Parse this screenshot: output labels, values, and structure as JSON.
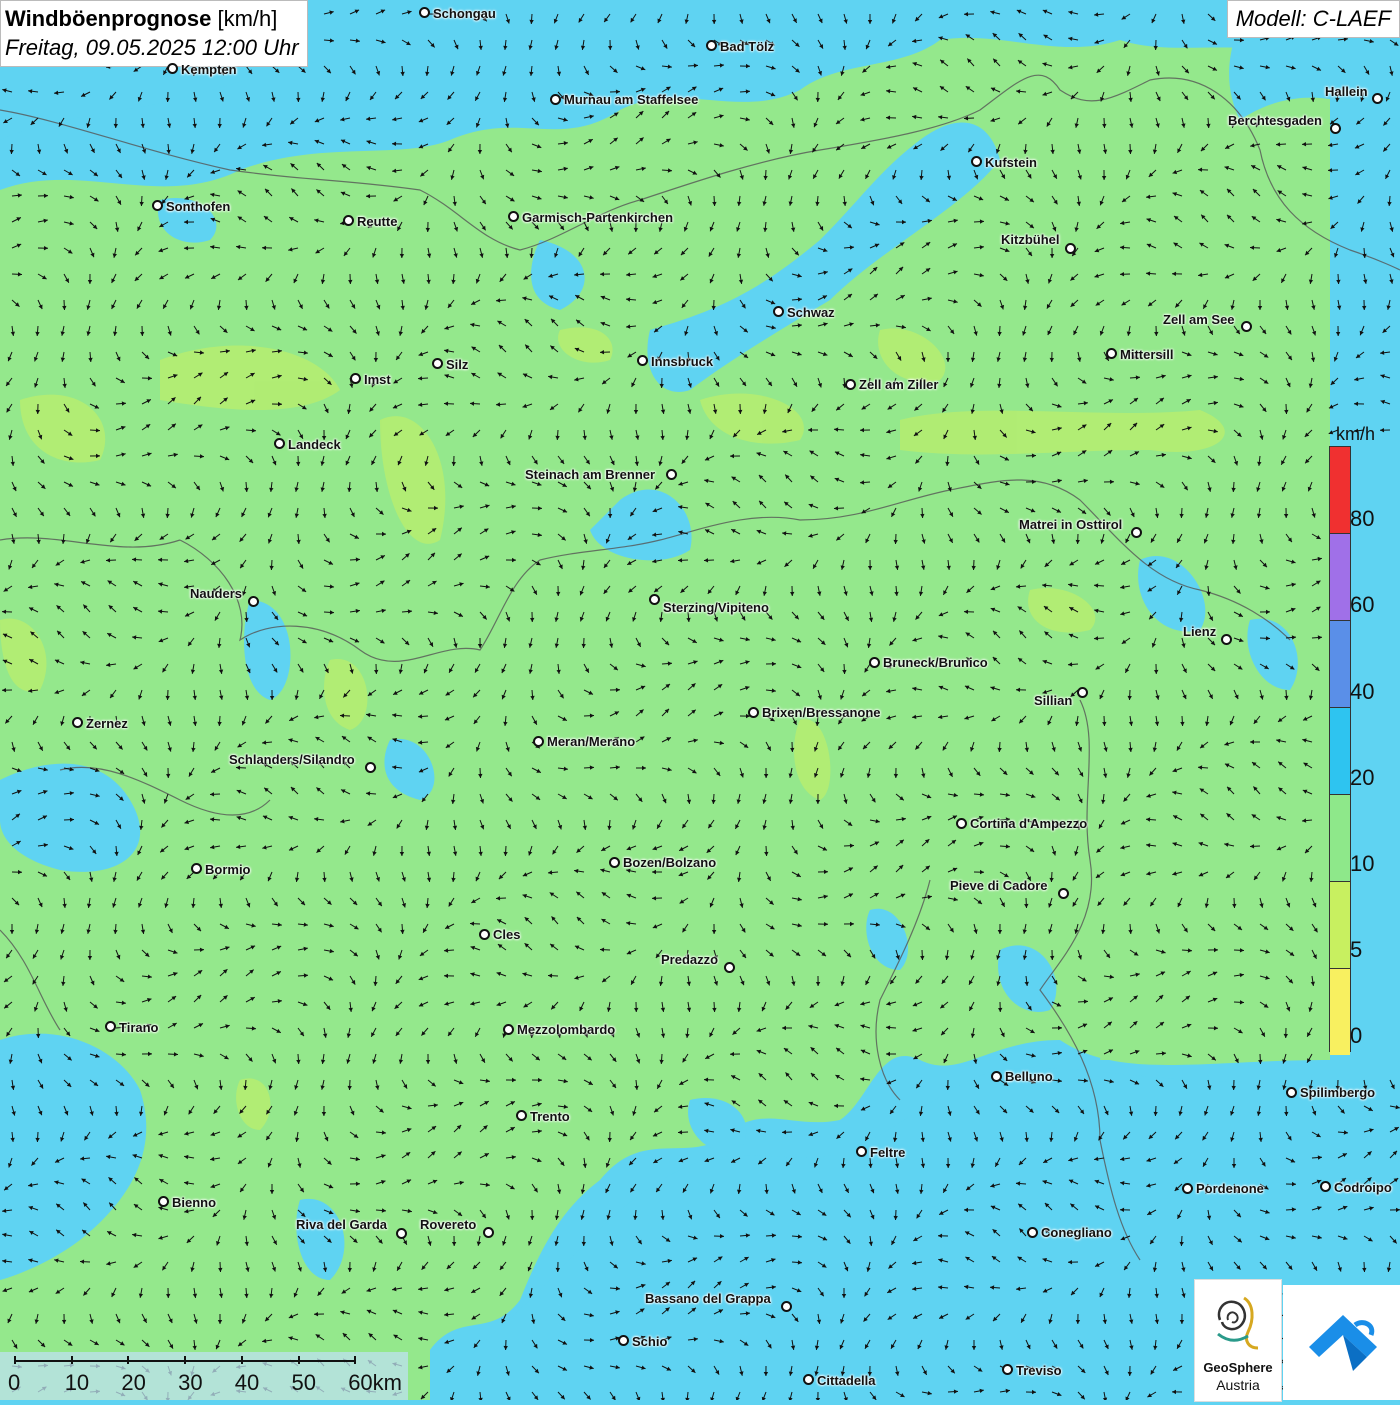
{
  "title": {
    "bold": "Windböenprognose",
    "unit": "[km/h]",
    "datetime": "Freitag, 09.05.2025 12:00 Uhr"
  },
  "model": "Modell: C-LAEF",
  "legend": {
    "unit": "km/h",
    "labels": [
      "80",
      "60",
      "40",
      "20",
      "10",
      "5",
      "0"
    ],
    "colors": [
      "#f03030",
      "#a070e8",
      "#5a8fe8",
      "#2ec4f0",
      "#8ee88a",
      "#c8f060",
      "#f8f060"
    ]
  },
  "scale": {
    "labels": [
      "0",
      "10",
      "20",
      "30",
      "40",
      "50",
      "60km"
    ]
  },
  "logos": {
    "geosphere_line1": "GeoSphere",
    "geosphere_line2": "Austria",
    "app_icon": "wind-app-icon"
  },
  "cities": [
    {
      "name": "Schongau"
    },
    {
      "name": "Bad Tölz"
    },
    {
      "name": "Kempten"
    },
    {
      "name": "Murnau am Staffelsee"
    },
    {
      "name": "Hallein"
    },
    {
      "name": "Berchtesgaden"
    },
    {
      "name": "Kufstein"
    },
    {
      "name": "Sonthofen"
    },
    {
      "name": "Reutte"
    },
    {
      "name": "Garmisch-Partenkirchen"
    },
    {
      "name": "Kitzbühel"
    },
    {
      "name": "Schwaz"
    },
    {
      "name": "Zell am See"
    },
    {
      "name": "Mittersill"
    },
    {
      "name": "Innsbruck"
    },
    {
      "name": "Silz"
    },
    {
      "name": "Imst"
    },
    {
      "name": "Zell am Ziller"
    },
    {
      "name": "Landeck"
    },
    {
      "name": "Steinach am Brenner"
    },
    {
      "name": "Matrei in Osttirol"
    },
    {
      "name": "Nauders"
    },
    {
      "name": "Sterzing/Vipiteno"
    },
    {
      "name": "Lienz"
    },
    {
      "name": "Bruneck/Brunico"
    },
    {
      "name": "Sillian"
    },
    {
      "name": "Zernez"
    },
    {
      "name": "Brixen/Bressanone"
    },
    {
      "name": "Meran/Merano"
    },
    {
      "name": "Schlanders/Silandro"
    },
    {
      "name": "Cortina d'Ampezzo"
    },
    {
      "name": "Bormio"
    },
    {
      "name": "Bozen/Bolzano"
    },
    {
      "name": "Pieve di Cadore"
    },
    {
      "name": "Cles"
    },
    {
      "name": "Predazzo"
    },
    {
      "name": "Tirano"
    },
    {
      "name": "Mezzolombardo"
    },
    {
      "name": "Belluno"
    },
    {
      "name": "Spilimbergo"
    },
    {
      "name": "Trento"
    },
    {
      "name": "Feltre"
    },
    {
      "name": "Pordenone"
    },
    {
      "name": "Codroipo"
    },
    {
      "name": "Bienno"
    },
    {
      "name": "Riva del Garda"
    },
    {
      "name": "Rovereto"
    },
    {
      "name": "Conegliano"
    },
    {
      "name": "Bassano del Grappa"
    },
    {
      "name": "Schio"
    },
    {
      "name": "Treviso"
    },
    {
      "name": "Cittadella"
    }
  ]
}
